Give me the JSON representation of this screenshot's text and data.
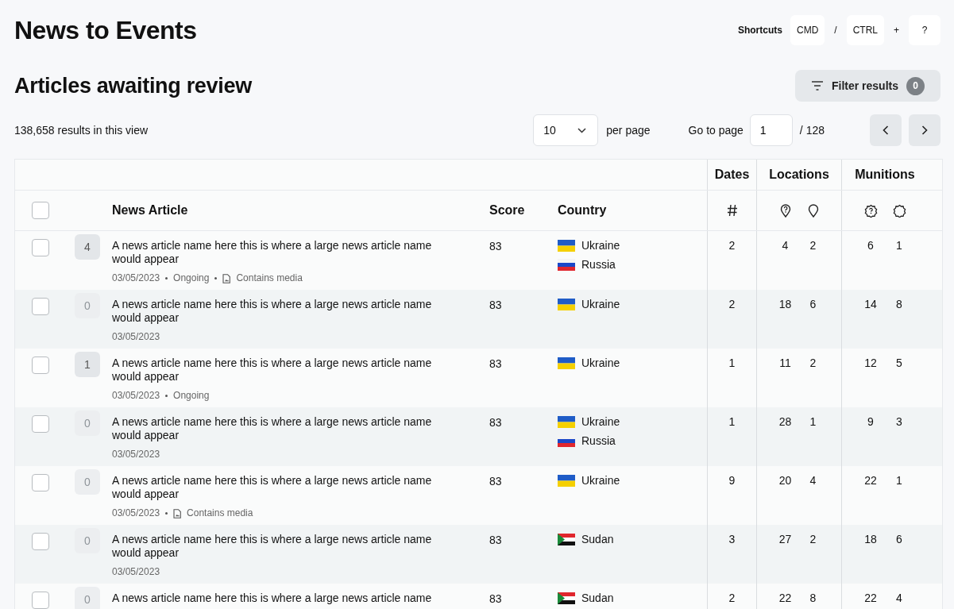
{
  "title": "News to Events",
  "shortcuts": {
    "label": "Shortcuts",
    "keys": [
      {
        "kind": "key",
        "text": "CMD"
      },
      {
        "kind": "sep",
        "text": "/"
      },
      {
        "kind": "key",
        "text": "CTRL"
      },
      {
        "kind": "sep",
        "text": "+"
      },
      {
        "kind": "key",
        "text": "?"
      }
    ]
  },
  "section_title": "Articles awaiting review",
  "filter": {
    "label": "Filter results",
    "count": "0"
  },
  "results_count": "138,658 results in this view",
  "per_page": {
    "value": "10",
    "label": "per page"
  },
  "go_to_page": {
    "label": "Go to page",
    "value": "1",
    "total": "/ 128"
  },
  "table": {
    "groups": [
      "Dates",
      "Locations",
      "Munitions"
    ],
    "columns": [
      "News Article",
      "Score",
      "Country"
    ],
    "all_selected": false,
    "sub_columns": [
      {
        "kind": "hash"
      },
      {
        "kind": "pin-question"
      },
      {
        "kind": "pin"
      },
      {
        "kind": "gear-question"
      },
      {
        "kind": "gear"
      }
    ],
    "rows": [
      {
        "selected": false,
        "count": "4",
        "highlighted": true,
        "title": "A news article name here this is where a large news article name would appear",
        "meta": [
          {
            "kind": "date",
            "text": "03/05/2023"
          },
          {
            "kind": "status",
            "text": "Ongoing"
          },
          {
            "kind": "media",
            "text": "Contains media"
          }
        ],
        "score": "83",
        "countries": [
          {
            "kind": "ua",
            "name": "Ukraine"
          },
          {
            "kind": "ru",
            "name": "Russia"
          }
        ],
        "values": [
          "2",
          "4",
          "2",
          "6",
          "1"
        ]
      },
      {
        "selected": false,
        "count": "0",
        "highlighted": false,
        "title": "A news article name here this is where a large news article name would appear",
        "meta": [
          {
            "kind": "date",
            "text": "03/05/2023"
          }
        ],
        "score": "83",
        "countries": [
          {
            "kind": "ua",
            "name": "Ukraine"
          }
        ],
        "values": [
          "2",
          "18",
          "6",
          "14",
          "8"
        ]
      },
      {
        "selected": false,
        "count": "1",
        "highlighted": true,
        "title": "A news article name here this is where a large news article name would appear",
        "meta": [
          {
            "kind": "date",
            "text": "03/05/2023"
          },
          {
            "kind": "status",
            "text": "Ongoing"
          }
        ],
        "score": "83",
        "countries": [
          {
            "kind": "ua",
            "name": "Ukraine"
          }
        ],
        "values": [
          "1",
          "11",
          "2",
          "12",
          "5"
        ]
      },
      {
        "selected": false,
        "count": "0",
        "highlighted": false,
        "title": "A news article name here this is where a large news article name would appear",
        "meta": [
          {
            "kind": "date",
            "text": "03/05/2023"
          }
        ],
        "score": "83",
        "countries": [
          {
            "kind": "ua",
            "name": "Ukraine"
          },
          {
            "kind": "ru",
            "name": "Russia"
          }
        ],
        "values": [
          "1",
          "28",
          "1",
          "9",
          "3"
        ]
      },
      {
        "selected": false,
        "count": "0",
        "highlighted": false,
        "title": "A news article name here this is where a large news article name would appear",
        "meta": [
          {
            "kind": "date",
            "text": "03/05/2023"
          },
          {
            "kind": "media",
            "text": "Contains media"
          }
        ],
        "score": "83",
        "countries": [
          {
            "kind": "ua",
            "name": "Ukraine"
          }
        ],
        "values": [
          "9",
          "20",
          "4",
          "22",
          "1"
        ]
      },
      {
        "selected": false,
        "count": "0",
        "highlighted": false,
        "title": "A news article name here this is where a large news article name would appear",
        "meta": [
          {
            "kind": "date",
            "text": "03/05/2023"
          }
        ],
        "score": "83",
        "countries": [
          {
            "kind": "sd",
            "name": "Sudan"
          }
        ],
        "values": [
          "3",
          "27",
          "2",
          "18",
          "6"
        ]
      },
      {
        "selected": false,
        "count": "0",
        "highlighted": false,
        "title": "A news article name here this is where a large news article name",
        "meta": [],
        "score": "83",
        "countries": [
          {
            "kind": "sd",
            "name": "Sudan"
          }
        ],
        "values": [
          "2",
          "22",
          "8",
          "22",
          "4"
        ]
      }
    ]
  }
}
